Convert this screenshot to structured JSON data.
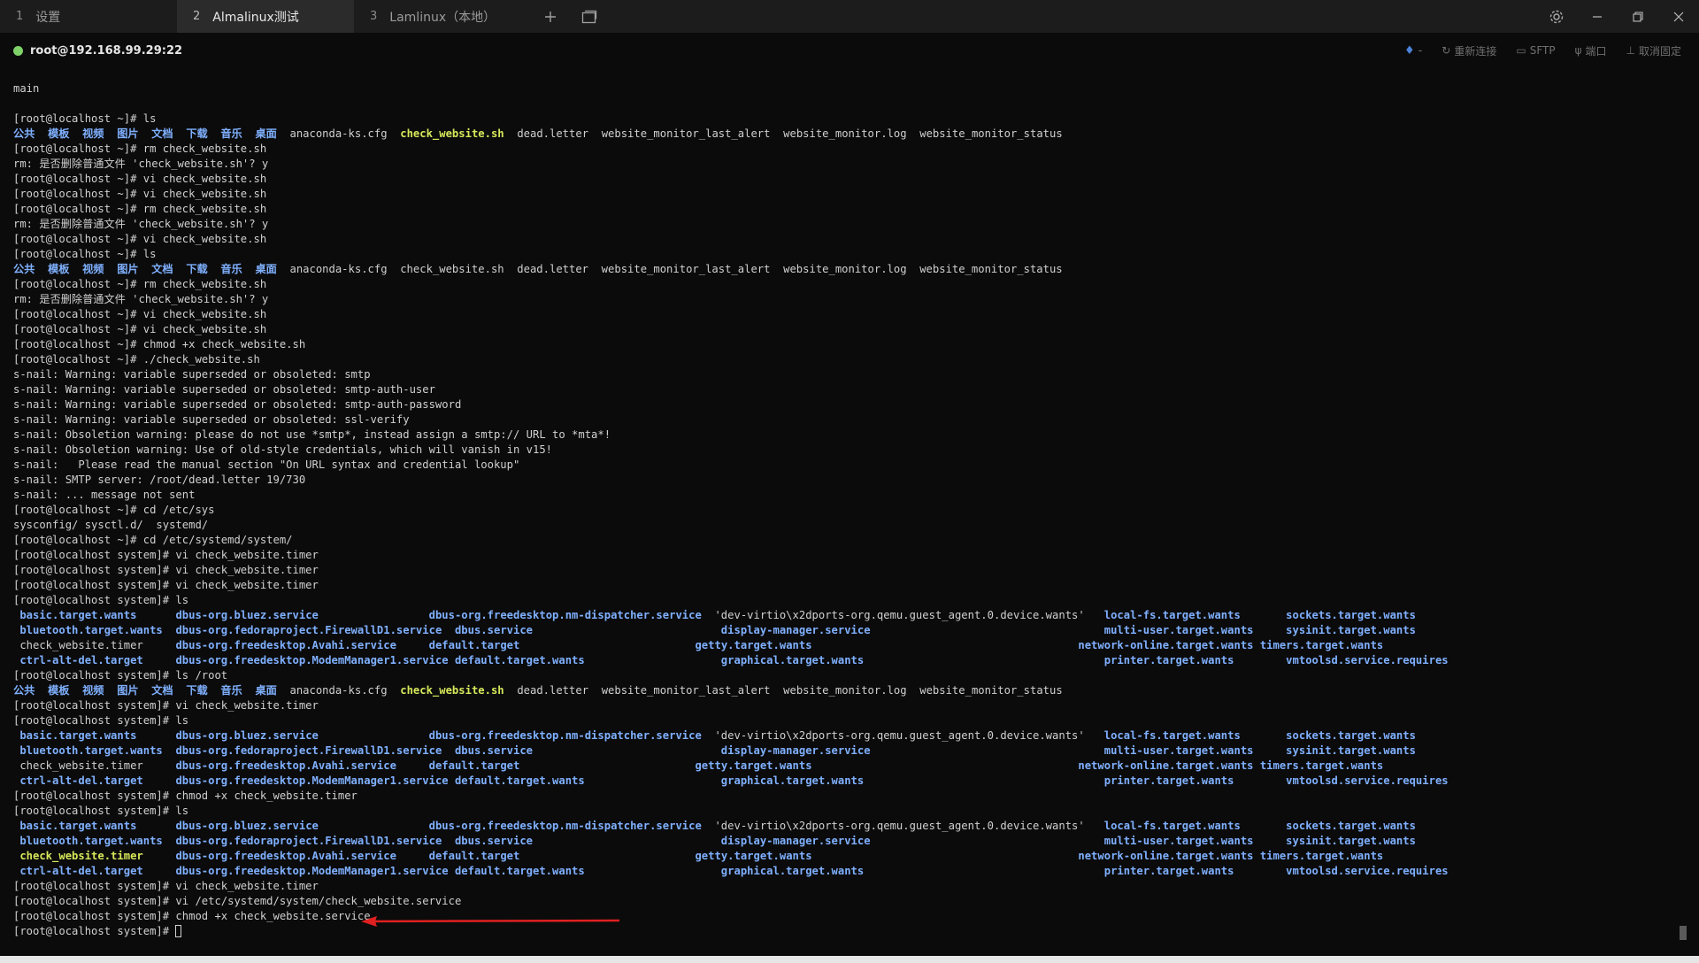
{
  "tabs": [
    {
      "num": "1",
      "label": "设置"
    },
    {
      "num": "2",
      "label": "Almalinux测试"
    },
    {
      "num": "3",
      "label": "Lamlinux（本地）"
    }
  ],
  "session": {
    "host": "root@192.168.99.29:22",
    "actions": [
      "重新连接",
      "SFTP",
      "端口",
      "取消固定"
    ]
  },
  "terminal_lines": [
    [
      {
        "t": "plain",
        "x": "main"
      }
    ],
    [
      {
        "t": "plain",
        "x": ""
      }
    ],
    [
      {
        "t": "plain",
        "x": "[root@localhost ~]# ls"
      }
    ],
    [
      {
        "t": "dir",
        "x": "公共"
      },
      {
        "t": "plain",
        "x": "  "
      },
      {
        "t": "dir",
        "x": "模板"
      },
      {
        "t": "plain",
        "x": "  "
      },
      {
        "t": "dir",
        "x": "视频"
      },
      {
        "t": "plain",
        "x": "  "
      },
      {
        "t": "dir",
        "x": "图片"
      },
      {
        "t": "plain",
        "x": "  "
      },
      {
        "t": "dir",
        "x": "文档"
      },
      {
        "t": "plain",
        "x": "  "
      },
      {
        "t": "dir",
        "x": "下载"
      },
      {
        "t": "plain",
        "x": "  "
      },
      {
        "t": "dir",
        "x": "音乐"
      },
      {
        "t": "plain",
        "x": "  "
      },
      {
        "t": "dir",
        "x": "桌面"
      },
      {
        "t": "plain",
        "x": "  anaconda-ks.cfg  "
      },
      {
        "t": "exec",
        "x": "check_website.sh"
      },
      {
        "t": "plain",
        "x": "  dead.letter  website_monitor_last_alert  website_monitor.log  website_monitor_status"
      }
    ],
    [
      {
        "t": "plain",
        "x": "[root@localhost ~]# rm check_website.sh"
      }
    ],
    [
      {
        "t": "plain",
        "x": "rm: 是否删除普通文件 'check_website.sh'? y"
      }
    ],
    [
      {
        "t": "plain",
        "x": "[root@localhost ~]# vi check_website.sh"
      }
    ],
    [
      {
        "t": "plain",
        "x": "[root@localhost ~]# vi check_website.sh"
      }
    ],
    [
      {
        "t": "plain",
        "x": "[root@localhost ~]# rm check_website.sh"
      }
    ],
    [
      {
        "t": "plain",
        "x": "rm: 是否删除普通文件 'check_website.sh'? y"
      }
    ],
    [
      {
        "t": "plain",
        "x": "[root@localhost ~]# vi check_website.sh"
      }
    ],
    [
      {
        "t": "plain",
        "x": "[root@localhost ~]# ls"
      }
    ],
    [
      {
        "t": "dir",
        "x": "公共"
      },
      {
        "t": "plain",
        "x": "  "
      },
      {
        "t": "dir",
        "x": "模板"
      },
      {
        "t": "plain",
        "x": "  "
      },
      {
        "t": "dir",
        "x": "视频"
      },
      {
        "t": "plain",
        "x": "  "
      },
      {
        "t": "dir",
        "x": "图片"
      },
      {
        "t": "plain",
        "x": "  "
      },
      {
        "t": "dir",
        "x": "文档"
      },
      {
        "t": "plain",
        "x": "  "
      },
      {
        "t": "dir",
        "x": "下载"
      },
      {
        "t": "plain",
        "x": "  "
      },
      {
        "t": "dir",
        "x": "音乐"
      },
      {
        "t": "plain",
        "x": "  "
      },
      {
        "t": "dir",
        "x": "桌面"
      },
      {
        "t": "plain",
        "x": "  anaconda-ks.cfg  check_website.sh  dead.letter  website_monitor_last_alert  website_monitor.log  website_monitor_status"
      }
    ],
    [
      {
        "t": "plain",
        "x": "[root@localhost ~]# rm check_website.sh"
      }
    ],
    [
      {
        "t": "plain",
        "x": "rm: 是否删除普通文件 'check_website.sh'? y"
      }
    ],
    [
      {
        "t": "plain",
        "x": "[root@localhost ~]# vi check_website.sh"
      }
    ],
    [
      {
        "t": "plain",
        "x": "[root@localhost ~]# vi check_website.sh"
      }
    ],
    [
      {
        "t": "plain",
        "x": "[root@localhost ~]# chmod +x check_website.sh"
      }
    ],
    [
      {
        "t": "plain",
        "x": "[root@localhost ~]# ./check_website.sh"
      }
    ],
    [
      {
        "t": "plain",
        "x": "s-nail: Warning: variable superseded or obsoleted: smtp"
      }
    ],
    [
      {
        "t": "plain",
        "x": "s-nail: Warning: variable superseded or obsoleted: smtp-auth-user"
      }
    ],
    [
      {
        "t": "plain",
        "x": "s-nail: Warning: variable superseded or obsoleted: smtp-auth-password"
      }
    ],
    [
      {
        "t": "plain",
        "x": "s-nail: Warning: variable superseded or obsoleted: ssl-verify"
      }
    ],
    [
      {
        "t": "plain",
        "x": "s-nail: Obsoletion warning: please do not use *smtp*, instead assign a smtp:// URL to *mta*!"
      }
    ],
    [
      {
        "t": "plain",
        "x": "s-nail: Obsoletion warning: Use of old-style credentials, which will vanish in v15!"
      }
    ],
    [
      {
        "t": "plain",
        "x": "s-nail:   Please read the manual section \"On URL syntax and credential lookup\""
      }
    ],
    [
      {
        "t": "plain",
        "x": "s-nail: SMTP server: /root/dead.letter 19/730"
      }
    ],
    [
      {
        "t": "plain",
        "x": "s-nail: ... message not sent"
      }
    ],
    [
      {
        "t": "plain",
        "x": "[root@localhost ~]# cd /etc/sys"
      }
    ],
    [
      {
        "t": "plain",
        "x": "sysconfig/ sysctl.d/  systemd/"
      }
    ],
    [
      {
        "t": "plain",
        "x": "[root@localhost ~]# cd /etc/systemd/system/"
      }
    ],
    [
      {
        "t": "plain",
        "x": "[root@localhost system]# vi check_website.timer"
      }
    ],
    [
      {
        "t": "plain",
        "x": "[root@localhost system]# vi check_website.timer"
      }
    ],
    [
      {
        "t": "plain",
        "x": "[root@localhost system]# vi check_website.timer"
      }
    ],
    [
      {
        "t": "plain",
        "x": "[root@localhost system]# ls"
      }
    ],
    [
      {
        "t": "dir",
        "x": " basic.target.wants     "
      },
      {
        "t": "dir",
        "x": " dbus-org.bluez.service                "
      },
      {
        "t": "dir",
        "x": " dbus-org.freedesktop.nm-dispatcher.service"
      },
      {
        "t": "plain",
        "x": "  'dev-virtio\\x2dports-org.qemu.guest_agent.0.device.wants'  "
      },
      {
        "t": "dir",
        "x": " local-fs.target.wants      "
      },
      {
        "t": "dir",
        "x": " sockets.target.wants"
      }
    ],
    [
      {
        "t": "dir",
        "x": " bluetooth.target.wants "
      },
      {
        "t": "dir",
        "x": " dbus-org.fedoraproject.FirewallD1.service "
      },
      {
        "t": "dir",
        "x": " dbus.service                          "
      },
      {
        "t": "dir",
        "x": "   display-manager.service                                   "
      },
      {
        "t": "dir",
        "x": " multi-user.target.wants    "
      },
      {
        "t": "dir",
        "x": " sysinit.target.wants"
      }
    ],
    [
      {
        "t": "plain",
        "x": " check_website.timer    "
      },
      {
        "t": "dir",
        "x": " dbus-org.freedesktop.Avahi.service    "
      },
      {
        "t": "dir",
        "x": " default.target                        "
      },
      {
        "t": "dir",
        "x": "   getty.target.wants                                        "
      },
      {
        "t": "dir",
        "x": " network-online.target.wants"
      },
      {
        "t": "dir",
        "x": " timers.target.wants"
      }
    ],
    [
      {
        "t": "dir",
        "x": " ctrl-alt-del.target    "
      },
      {
        "t": "dir",
        "x": " dbus-org.freedesktop.ModemManager1.service"
      },
      {
        "t": "dir",
        "x": " default.target.wants                  "
      },
      {
        "t": "dir",
        "x": "   graphical.target.wants                                    "
      },
      {
        "t": "dir",
        "x": " printer.target.wants       "
      },
      {
        "t": "dir",
        "x": " vmtoolsd.service.requires"
      }
    ],
    [
      {
        "t": "plain",
        "x": "[root@localhost system]# ls /root"
      }
    ],
    [
      {
        "t": "dir",
        "x": "公共"
      },
      {
        "t": "plain",
        "x": "  "
      },
      {
        "t": "dir",
        "x": "模板"
      },
      {
        "t": "plain",
        "x": "  "
      },
      {
        "t": "dir",
        "x": "视频"
      },
      {
        "t": "plain",
        "x": "  "
      },
      {
        "t": "dir",
        "x": "图片"
      },
      {
        "t": "plain",
        "x": "  "
      },
      {
        "t": "dir",
        "x": "文档"
      },
      {
        "t": "plain",
        "x": "  "
      },
      {
        "t": "dir",
        "x": "下载"
      },
      {
        "t": "plain",
        "x": "  "
      },
      {
        "t": "dir",
        "x": "音乐"
      },
      {
        "t": "plain",
        "x": "  "
      },
      {
        "t": "dir",
        "x": "桌面"
      },
      {
        "t": "plain",
        "x": "  anaconda-ks.cfg  "
      },
      {
        "t": "exec",
        "x": "check_website.sh"
      },
      {
        "t": "plain",
        "x": "  dead.letter  website_monitor_last_alert  website_monitor.log  website_monitor_status"
      }
    ],
    [
      {
        "t": "plain",
        "x": "[root@localhost system]# vi check_website.timer"
      }
    ],
    [
      {
        "t": "plain",
        "x": "[root@localhost system]# ls"
      }
    ],
    [
      {
        "t": "dir",
        "x": " basic.target.wants     "
      },
      {
        "t": "dir",
        "x": " dbus-org.bluez.service                "
      },
      {
        "t": "dir",
        "x": " dbus-org.freedesktop.nm-dispatcher.service"
      },
      {
        "t": "plain",
        "x": "  'dev-virtio\\x2dports-org.qemu.guest_agent.0.device.wants'  "
      },
      {
        "t": "dir",
        "x": " local-fs.target.wants      "
      },
      {
        "t": "dir",
        "x": " sockets.target.wants"
      }
    ],
    [
      {
        "t": "dir",
        "x": " bluetooth.target.wants "
      },
      {
        "t": "dir",
        "x": " dbus-org.fedoraproject.FirewallD1.service "
      },
      {
        "t": "dir",
        "x": " dbus.service                          "
      },
      {
        "t": "dir",
        "x": "   display-manager.service                                   "
      },
      {
        "t": "dir",
        "x": " multi-user.target.wants    "
      },
      {
        "t": "dir",
        "x": " sysinit.target.wants"
      }
    ],
    [
      {
        "t": "plain",
        "x": " check_website.timer    "
      },
      {
        "t": "dir",
        "x": " dbus-org.freedesktop.Avahi.service    "
      },
      {
        "t": "dir",
        "x": " default.target                        "
      },
      {
        "t": "dir",
        "x": "   getty.target.wants                                        "
      },
      {
        "t": "dir",
        "x": " network-online.target.wants"
      },
      {
        "t": "dir",
        "x": " timers.target.wants"
      }
    ],
    [
      {
        "t": "dir",
        "x": " ctrl-alt-del.target    "
      },
      {
        "t": "dir",
        "x": " dbus-org.freedesktop.ModemManager1.service"
      },
      {
        "t": "dir",
        "x": " default.target.wants                  "
      },
      {
        "t": "dir",
        "x": "   graphical.target.wants                                    "
      },
      {
        "t": "dir",
        "x": " printer.target.wants       "
      },
      {
        "t": "dir",
        "x": " vmtoolsd.service.requires"
      }
    ],
    [
      {
        "t": "plain",
        "x": "[root@localhost system]# chmod +x check_website.timer"
      }
    ],
    [
      {
        "t": "plain",
        "x": "[root@localhost system]# ls"
      }
    ],
    [
      {
        "t": "dir",
        "x": " basic.target.wants     "
      },
      {
        "t": "dir",
        "x": " dbus-org.bluez.service                "
      },
      {
        "t": "dir",
        "x": " dbus-org.freedesktop.nm-dispatcher.service"
      },
      {
        "t": "plain",
        "x": "  'dev-virtio\\x2dports-org.qemu.guest_agent.0.device.wants'  "
      },
      {
        "t": "dir",
        "x": " local-fs.target.wants      "
      },
      {
        "t": "dir",
        "x": " sockets.target.wants"
      }
    ],
    [
      {
        "t": "dir",
        "x": " bluetooth.target.wants "
      },
      {
        "t": "dir",
        "x": " dbus-org.fedoraproject.FirewallD1.service "
      },
      {
        "t": "dir",
        "x": " dbus.service                          "
      },
      {
        "t": "dir",
        "x": "   display-manager.service                                   "
      },
      {
        "t": "dir",
        "x": " multi-user.target.wants    "
      },
      {
        "t": "dir",
        "x": " sysinit.target.wants"
      }
    ],
    [
      {
        "t": "exec",
        "x": " check_website.timer    "
      },
      {
        "t": "dir",
        "x": " dbus-org.freedesktop.Avahi.service    "
      },
      {
        "t": "dir",
        "x": " default.target                        "
      },
      {
        "t": "dir",
        "x": "   getty.target.wants                                        "
      },
      {
        "t": "dir",
        "x": " network-online.target.wants"
      },
      {
        "t": "dir",
        "x": " timers.target.wants"
      }
    ],
    [
      {
        "t": "dir",
        "x": " ctrl-alt-del.target    "
      },
      {
        "t": "dir",
        "x": " dbus-org.freedesktop.ModemManager1.service"
      },
      {
        "t": "dir",
        "x": " default.target.wants                  "
      },
      {
        "t": "dir",
        "x": "   graphical.target.wants                                    "
      },
      {
        "t": "dir",
        "x": " printer.target.wants       "
      },
      {
        "t": "dir",
        "x": " vmtoolsd.service.requires"
      }
    ],
    [
      {
        "t": "plain",
        "x": "[root@localhost system]# vi check_website.timer"
      }
    ],
    [
      {
        "t": "plain",
        "x": "[root@localhost system]# vi /etc/systemd/system/check_website.service"
      }
    ],
    [
      {
        "t": "plain",
        "x": "[root@localhost system]# chmod +x check_website.service"
      }
    ],
    [
      {
        "t": "plain",
        "x": "[root@localhost system]# "
      }
    ]
  ],
  "colors": {
    "dir": "#7fb0ff",
    "exec": "#d6e85a",
    "status_ok": "#7fd26a",
    "annotation_arrow": "#e02020"
  },
  "icons": [
    "plus-icon",
    "window-icon",
    "gear-icon",
    "minimize-icon",
    "restore-icon",
    "close-icon",
    "bulb-icon",
    "reconnect-icon",
    "sftp-folder-icon",
    "port-icon",
    "pin-icon"
  ]
}
